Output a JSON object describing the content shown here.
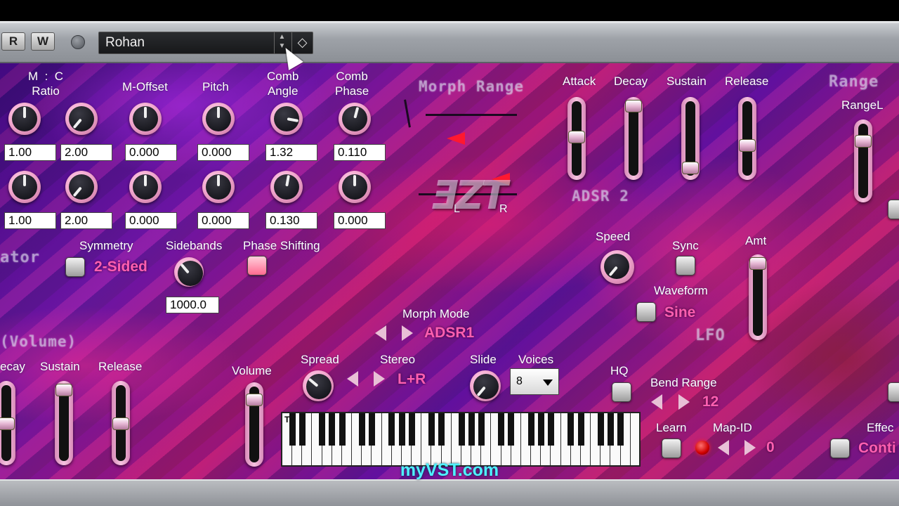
{
  "hostbar": {
    "read_label": "R",
    "write_label": "W",
    "preset_name": "Rohan"
  },
  "oscillator": {
    "section_title": "ator",
    "headers": {
      "ratio": "M  :  C\nRatio",
      "moffset": "M-Offset",
      "pitch": "Pitch",
      "comb_angle": "Comb\nAngle",
      "comb_phase": "Comb\nPhase"
    },
    "row1": [
      "1.00",
      "2.00",
      "0.000",
      "0.000",
      "1.32",
      "0.110"
    ],
    "row2": [
      "1.00",
      "2.00",
      "0.000",
      "0.000",
      "0.130",
      "0.000"
    ],
    "symmetry_label": "Symmetry",
    "symmetry_value": "2-Sided",
    "sidebands_label": "Sidebands",
    "sidebands_value": "1000.0",
    "phase_shifting_label": "Phase Shifting"
  },
  "morph": {
    "range_title": "Morph Range",
    "left": "L",
    "right": "R",
    "mode_label": "Morph Mode",
    "mode_value": "ADSR1"
  },
  "adsr2": {
    "title": "ADSR 2",
    "attack": "Attack",
    "decay": "Decay",
    "sustain": "Sustain",
    "release": "Release"
  },
  "lfo": {
    "title": "LFO",
    "speed": "Speed",
    "sync": "Sync",
    "amt": "Amt",
    "waveform_label": "Waveform",
    "waveform_value": "Sine"
  },
  "range": {
    "title": "Range",
    "rangel": "RangeL"
  },
  "volume_env": {
    "title": "(Volume)",
    "decay": "ecay",
    "sustain": "Sustain",
    "release": "Release"
  },
  "global": {
    "volume": "Volume",
    "spread": "Spread",
    "stereo": "Stereo",
    "stereo_value": "L+R",
    "slide": "Slide",
    "voices": "Voices",
    "voices_value": "8",
    "hq": "HQ",
    "bend_range": "Bend Range",
    "bend_value": "12",
    "learn": "Learn",
    "map_id": "Map-ID",
    "map_value": "0",
    "effect": "Effec",
    "effect_value": "Conti"
  },
  "keyboard": {
    "marker": "T"
  },
  "watermark": "myVST.com",
  "colors": {
    "accent_pink": "#ff5fb0",
    "watermark_cyan": "#4ff0ff",
    "led_red": "#ff2020"
  }
}
